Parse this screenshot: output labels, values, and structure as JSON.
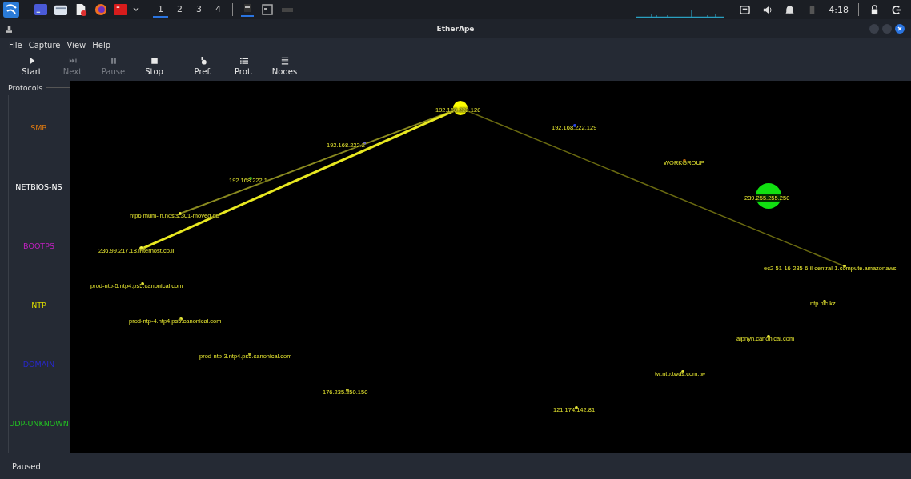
{
  "taskbar": {
    "workspaces": [
      {
        "label": "1",
        "selected": true
      },
      {
        "label": "2",
        "selected": false
      },
      {
        "label": "3",
        "selected": false
      },
      {
        "label": "4",
        "selected": false
      }
    ],
    "clock": "4:18"
  },
  "window": {
    "title": "EtherApe"
  },
  "menu": [
    "File",
    "Capture",
    "View",
    "Help"
  ],
  "toolbar": [
    {
      "label": "Start",
      "disabled": false
    },
    {
      "label": "Next",
      "disabled": true
    },
    {
      "label": "Pause",
      "disabled": true
    },
    {
      "label": "Stop",
      "disabled": false
    },
    {
      "label": "Pref.",
      "disabled": false
    },
    {
      "label": "Prot.",
      "disabled": false
    },
    {
      "label": "Nodes",
      "disabled": false
    }
  ],
  "protocols": {
    "title": "Protocols",
    "items": [
      {
        "name": "SMB",
        "color": "#e07a10"
      },
      {
        "name": "NETBIOS-NS",
        "color": "#ffffff"
      },
      {
        "name": "BOOTPS",
        "color": "#c020c0"
      },
      {
        "name": "NTP",
        "color": "#d8d800"
      },
      {
        "name": "DOMAIN",
        "color": "#2828c8"
      },
      {
        "name": "UDP-UNKNOWN",
        "color": "#22c022"
      }
    ]
  },
  "nodes": [
    {
      "label": "192.168.222.128",
      "color": "#ffff00"
    },
    {
      "label": "192.168.222.129",
      "color": "#3050ff"
    },
    {
      "label": "192.168.222.2",
      "color": "#8080ff"
    },
    {
      "label": "WORKGROUP",
      "color": "#e07a10"
    },
    {
      "label": "192.168.222.1",
      "color": "#22c022"
    },
    {
      "label": "239.255.255.250",
      "color": "#11e011"
    },
    {
      "label": "ntp6.mum-in.hosts.301-moved.de",
      "color": "#ffff40"
    },
    {
      "label": "236.99.217.18.interhost.co.il",
      "color": "#ffff40"
    },
    {
      "label": "ec2-51-16-235-6.il-central-1.compute.amazonaws",
      "color": "#ffff40"
    },
    {
      "label": "prod-ntp-5.ntp4.ps5.canonical.com",
      "color": "#ffff40"
    },
    {
      "label": "ntp.nic.kz",
      "color": "#ffff40"
    },
    {
      "label": "prod-ntp-4.ntp4.ps5.canonical.com",
      "color": "#ffff40"
    },
    {
      "label": "alphyn.canonical.com",
      "color": "#ffff40"
    },
    {
      "label": "prod-ntp-3.ntp4.ps5.canonical.com",
      "color": "#ffff40"
    },
    {
      "label": "tw.ntp.twds.com.tw",
      "color": "#ffff40"
    },
    {
      "label": "176.235.250.150",
      "color": "#ffff40"
    },
    {
      "label": "121.174.142.81",
      "color": "#ffff40"
    }
  ],
  "status_bar": "Paused"
}
